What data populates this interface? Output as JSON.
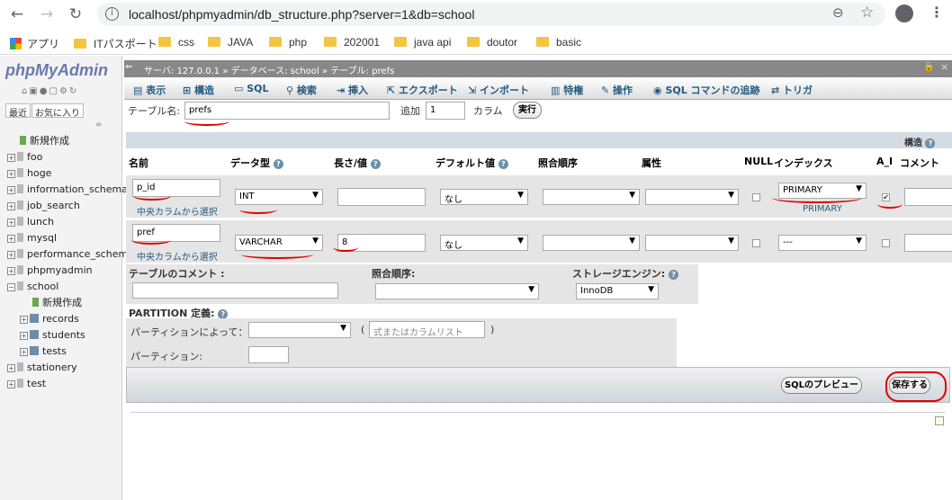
{
  "browser": {
    "url": "localhost/phpmyadmin/db_structure.php?server=1&db=school",
    "bookmarks": [
      "アプリ",
      "ITパスポート",
      "css",
      "JAVA",
      "php",
      "202001",
      "java api",
      "doutor",
      "basic"
    ]
  },
  "sidebar": {
    "logo": "phpMyAdmin",
    "recent": "最近",
    "favorites": "お気に入り",
    "items": [
      {
        "label": "新規作成"
      },
      {
        "label": "foo"
      },
      {
        "label": "hoge"
      },
      {
        "label": "information_schema"
      },
      {
        "label": "job_search"
      },
      {
        "label": "lunch"
      },
      {
        "label": "mysql"
      },
      {
        "label": "performance_schema"
      },
      {
        "label": "phpmyadmin"
      },
      {
        "label": "school"
      },
      {
        "label": "新規作成"
      },
      {
        "label": "records"
      },
      {
        "label": "students"
      },
      {
        "label": "tests"
      },
      {
        "label": "stationery"
      },
      {
        "label": "test"
      }
    ]
  },
  "breadcrumb": {
    "server": "サーバ: 127.0.0.1",
    "database": "データベース: school",
    "table": "テーブル: prefs"
  },
  "tabs": [
    "表示",
    "構造",
    "SQL",
    "検索",
    "挿入",
    "エクスポート",
    "インポート",
    "特権",
    "操作",
    "SQL コマンドの追跡",
    "トリガ"
  ],
  "form": {
    "table_name_label": "テーブル名:",
    "table_name_value": "prefs",
    "add_label": "追加",
    "add_count": "1",
    "column_label": "カラム",
    "go_button": "実行",
    "structure_label": "構造",
    "headers": {
      "name": "名前",
      "type": "データ型",
      "length": "長さ/値",
      "default": "デフォルト値",
      "collation": "照合順序",
      "attributes": "属性",
      "null": "NULL",
      "index": "インデックス",
      "ai": "A_I",
      "comment": "コメント"
    },
    "rows": [
      {
        "name": "p_id",
        "type": "INT",
        "length": "",
        "default": "なし",
        "index": "PRIMARY",
        "index_note": "PRIMARY",
        "central": "中央カラムから選択"
      },
      {
        "name": "pref",
        "type": "VARCHAR",
        "length": "8",
        "default": "なし",
        "index": "---",
        "central": "中央カラムから選択"
      }
    ],
    "table_comment_label": "テーブルのコメント :",
    "table_collation_label": "照合順序:",
    "storage_engine_label": "ストレージエンジン:",
    "storage_engine_value": "InnoDB",
    "partition_label": "PARTITION 定義:",
    "partition_by_label": "パーティションによって：",
    "partition_expr_placeholder": "式またはカラムリスト",
    "partitions_label": "パーティション:",
    "preview_button": "SQLのプレビュー",
    "save_button": "保存する"
  },
  "colors": {
    "accent": "#235a81",
    "annotation": "#e00000",
    "header_bg": "#888888"
  }
}
